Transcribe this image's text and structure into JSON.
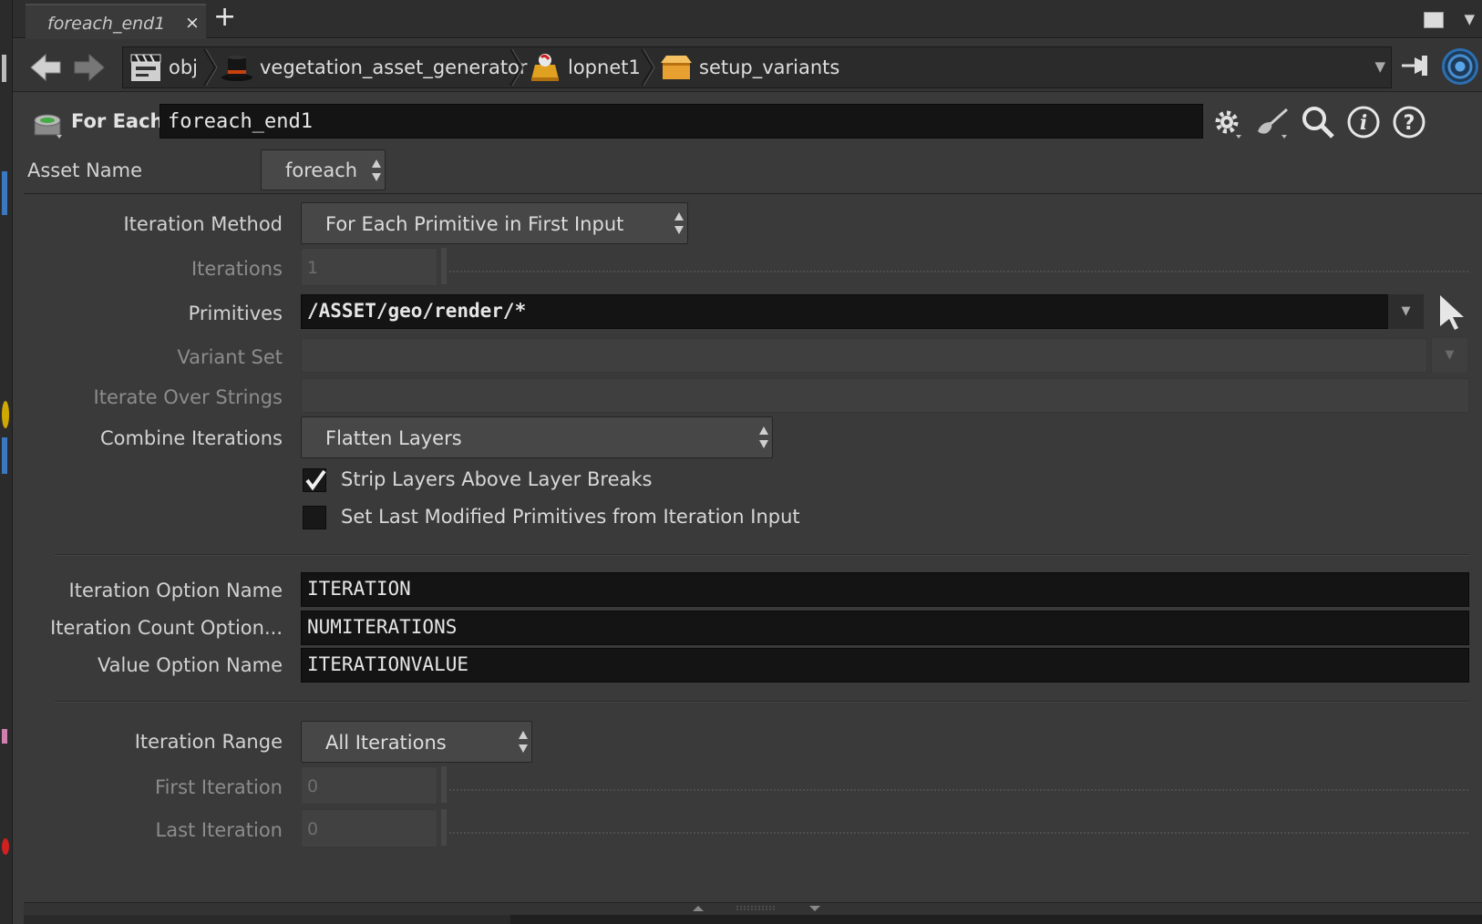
{
  "tab": {
    "label": "foreach_end1",
    "close": "×",
    "add": "+"
  },
  "breadcrumb": [
    {
      "label": "obj"
    },
    {
      "label": "vegetation_asset_generator"
    },
    {
      "label": "lopnet1"
    },
    {
      "label": "setup_variants"
    }
  ],
  "node": {
    "type_label": "For Each",
    "name": "foreach_end1"
  },
  "asset": {
    "label": "Asset Name",
    "value": "foreach"
  },
  "params": {
    "iteration_method": {
      "label": "Iteration Method",
      "value": "For Each Primitive in First Input"
    },
    "iterations": {
      "label": "Iterations",
      "value": "1"
    },
    "primitives": {
      "label": "Primitives",
      "value": "/ASSET/geo/render/*"
    },
    "variant_set": {
      "label": "Variant Set",
      "value": ""
    },
    "iterate_over_strings": {
      "label": "Iterate Over Strings",
      "value": ""
    },
    "combine_iterations": {
      "label": "Combine Iterations",
      "value": "Flatten Layers"
    },
    "strip_layers": {
      "label": "Strip Layers Above Layer Breaks",
      "checked": true
    },
    "set_last_modified": {
      "label": "Set Last Modified Primitives from Iteration Input",
      "checked": false
    },
    "iteration_option_name": {
      "label": "Iteration Option Name",
      "value": "ITERATION"
    },
    "iteration_count_option": {
      "label": "Iteration Count Option...",
      "value": "NUMITERATIONS"
    },
    "value_option_name": {
      "label": "Value Option Name",
      "value": "ITERATIONVALUE"
    },
    "iteration_range": {
      "label": "Iteration Range",
      "value": "All Iterations"
    },
    "first_iteration": {
      "label": "First Iteration",
      "value": "0"
    },
    "last_iteration": {
      "label": "Last Iteration",
      "value": "0"
    }
  },
  "icons": {
    "back": "back-arrow-icon",
    "forward": "forward-arrow-icon",
    "gear": "gear-icon",
    "paint": "paintbrush-icon",
    "search": "search-icon",
    "info": "info-icon",
    "help": "help-icon",
    "pin": "pin-icon",
    "target": "target-icon",
    "pointer": "select-pointer-icon"
  },
  "colors": {
    "accent_blue": "#2d6fb0",
    "panel_bg": "#3a3a3a",
    "field_bg": "#141414"
  }
}
